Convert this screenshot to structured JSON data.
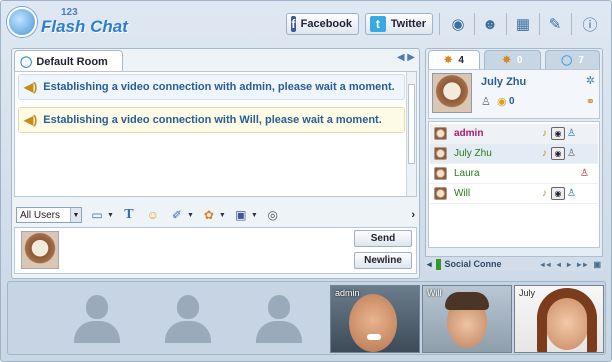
{
  "header": {
    "logo_num": "123",
    "logo_name": "Flash Chat",
    "facebook_label": "Facebook",
    "twitter_label": "Twitter"
  },
  "room": {
    "tab_label": "Default Room",
    "messages": [
      "Establishing a video connection with admin, please wait a moment.",
      "Establishing a video connection with Will, please wait a moment."
    ],
    "user_filter": "All Users",
    "send_label": "Send",
    "newline_label": "Newline"
  },
  "users_panel": {
    "tabs": [
      {
        "count": "4"
      },
      {
        "count": "0"
      },
      {
        "count": "7"
      }
    ],
    "me": {
      "name": "July Zhu",
      "coins": "0"
    },
    "list": [
      {
        "name": "admin",
        "color": "#b0186a"
      },
      {
        "name": "July Zhu",
        "color": "#2a7a1a"
      },
      {
        "name": "Laura",
        "color": "#2a7a1a"
      },
      {
        "name": "Will",
        "color": "#2a7a1a"
      }
    ],
    "social_label": "Social Conne"
  },
  "videos": {
    "labels": [
      "admin",
      "Will",
      "July"
    ]
  },
  "colors": {
    "accent": "#2a5e94",
    "admin": "#b0186a",
    "user": "#2a7a1a"
  }
}
